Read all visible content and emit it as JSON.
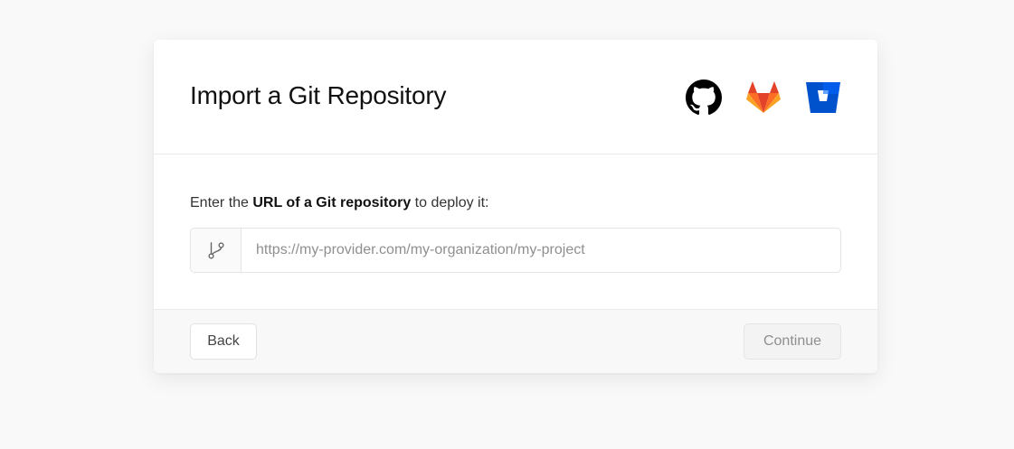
{
  "title": "Import a Git Repository",
  "providers": [
    {
      "name": "GitHub",
      "icon": "github-icon",
      "color": "#000000"
    },
    {
      "name": "GitLab",
      "icon": "gitlab-icon",
      "color": "#e24329"
    },
    {
      "name": "Bitbucket",
      "icon": "bitbucket-icon",
      "color": "#0052cc"
    }
  ],
  "prompt": {
    "before": "Enter the ",
    "bold": "URL of a Git repository",
    "after": " to deploy it:"
  },
  "url_field": {
    "icon": "git-branch-icon",
    "value": "",
    "placeholder": "https://my-provider.com/my-organization/my-project"
  },
  "footer": {
    "back_label": "Back",
    "continue_label": "Continue",
    "continue_disabled": true
  },
  "colors": {
    "page_bg": "#f9f9f9",
    "card_bg": "#ffffff",
    "footer_bg": "#f8f8f8",
    "text": "#111111",
    "muted": "#8f8f8f"
  }
}
